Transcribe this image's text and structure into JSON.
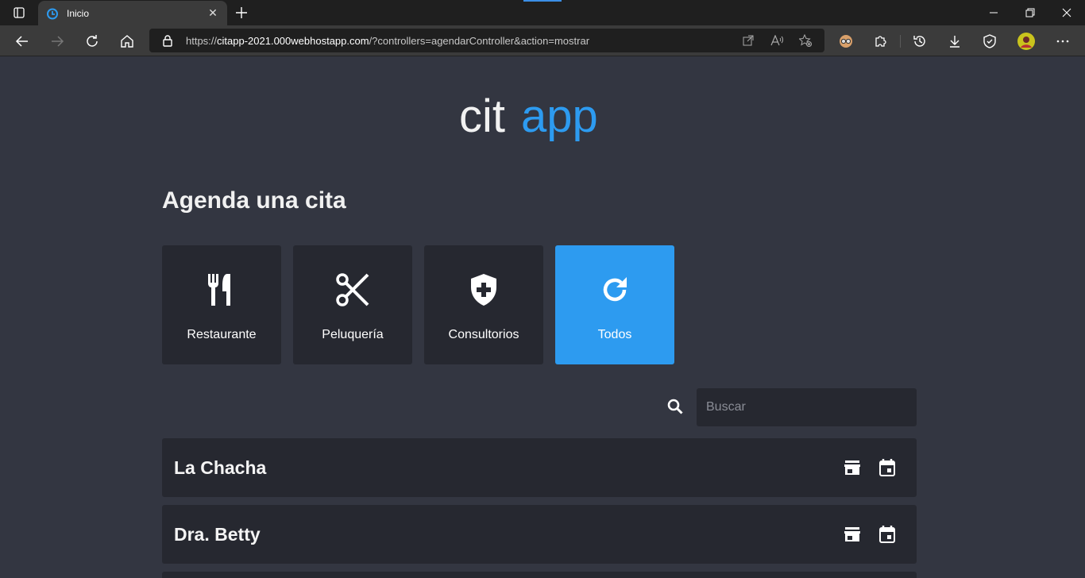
{
  "browser": {
    "tab_title": "Inicio",
    "url_prefix": "https://",
    "url_host": "citapp-2021.000webhostapp.com",
    "url_rest": "/?controllers=agendarController&action=mostrar"
  },
  "page": {
    "logo_text_left": "cit",
    "logo_text_right": "app",
    "title": "Agenda una cita",
    "accent_color": "#2d9bf0"
  },
  "categories": [
    {
      "label": "Restaurante",
      "icon": "restaurant-icon"
    },
    {
      "label": "Peluquería",
      "icon": "scissors-icon"
    },
    {
      "label": "Consultorios",
      "icon": "medical-shield-icon"
    },
    {
      "label": "Todos",
      "icon": "refresh-icon",
      "active": true
    }
  ],
  "search": {
    "placeholder": "Buscar"
  },
  "businesses": [
    {
      "name": "La Chacha"
    },
    {
      "name": "Dra. Betty"
    }
  ]
}
